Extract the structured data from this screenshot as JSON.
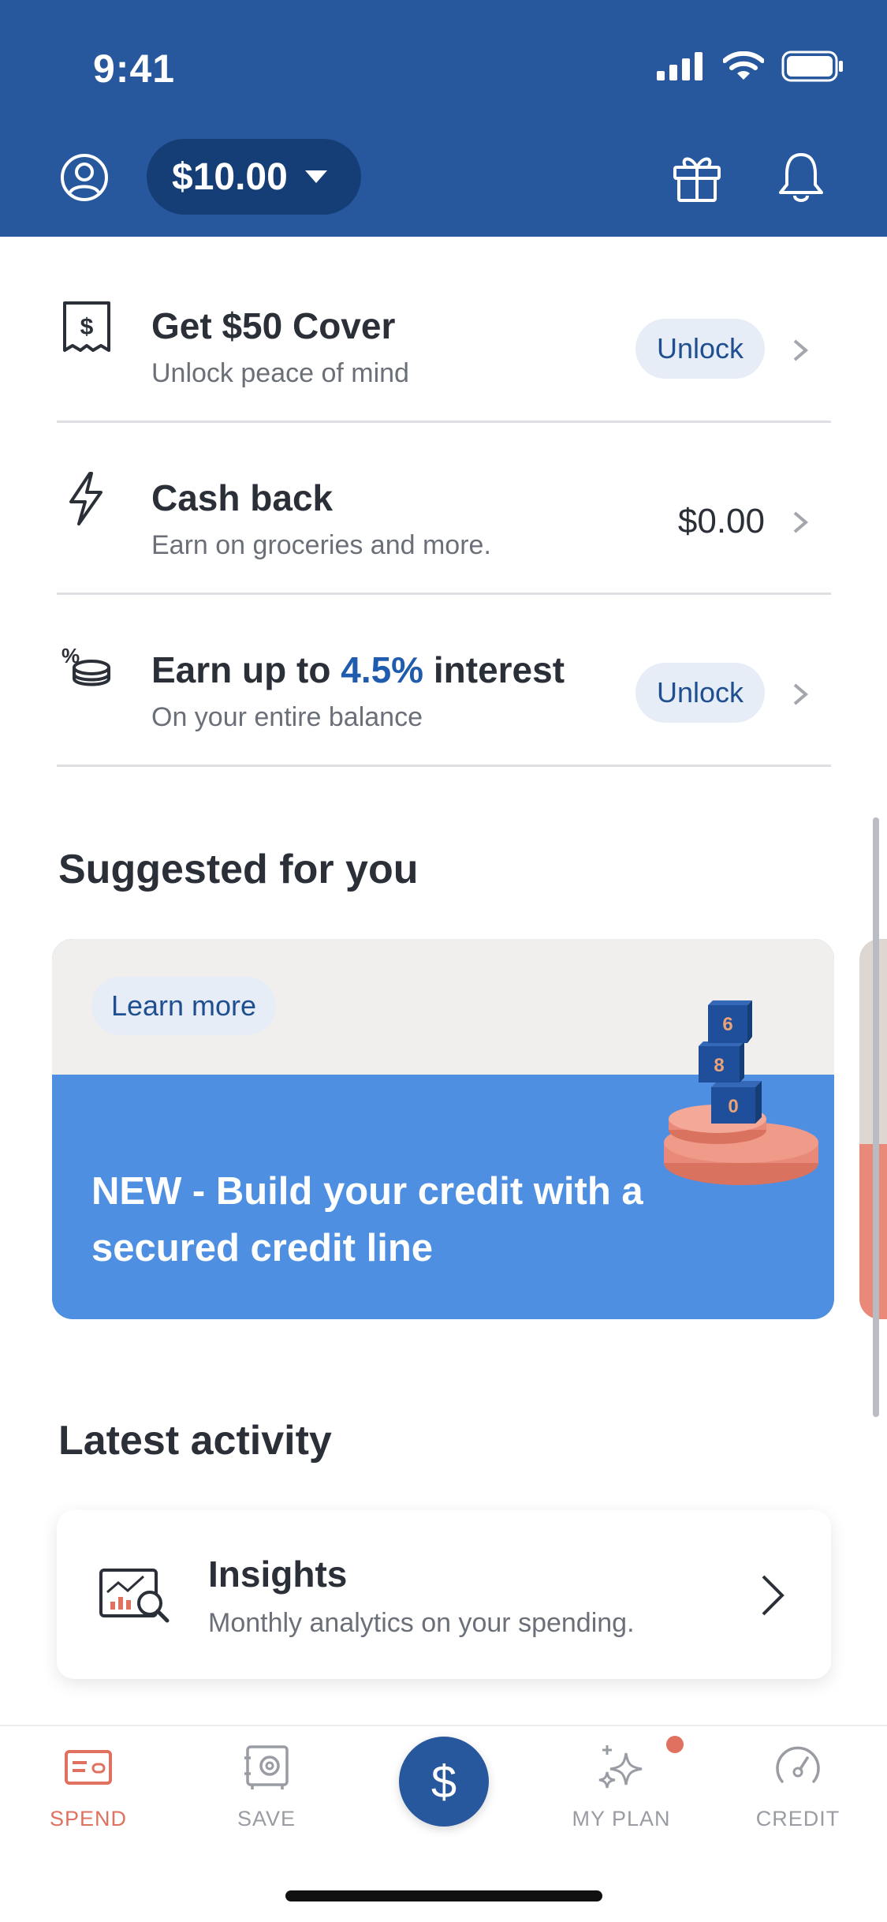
{
  "status_bar": {
    "time": "9:41"
  },
  "header": {
    "balance": "$10.00",
    "colors": {
      "header_bg": "#27579d",
      "pill_bg": "#163e76"
    }
  },
  "features": [
    {
      "title": "Get $50 Cover",
      "subtitle": "Unlock peace of mind",
      "action": "Unlock",
      "icon": "receipt-dollar-icon"
    },
    {
      "title": "Cash back",
      "subtitle": "Earn on groceries and more.",
      "value": "$0.00",
      "icon": "lightning-icon"
    },
    {
      "title_prefix": "Earn up to ",
      "title_accent": "4.5%",
      "title_suffix": " interest",
      "subtitle": "On your entire balance",
      "action": "Unlock",
      "icon": "percent-coins-icon"
    }
  ],
  "suggested": {
    "title": "Suggested for you",
    "card": {
      "learn_more": "Learn more",
      "text": "NEW - Build your credit with a secured credit line",
      "blocks": [
        "6",
        "8",
        "0"
      ]
    }
  },
  "latest": {
    "title": "Latest activity",
    "insights": {
      "title": "Insights",
      "subtitle": "Monthly analytics on your spending."
    }
  },
  "tabs": [
    {
      "label": "SPEND",
      "icon": "card-icon",
      "active": true
    },
    {
      "label": "SAVE",
      "icon": "safe-icon",
      "active": false
    },
    {
      "label": "$",
      "icon": "dollar-icon",
      "active": false
    },
    {
      "label": "MY PLAN",
      "icon": "sparkles-icon",
      "active": false
    },
    {
      "label": "CREDIT",
      "icon": "gauge-icon",
      "active": false
    }
  ],
  "colors": {
    "accent": "#1f5cae",
    "active_tab": "#e0705f",
    "promo_blue": "#4e8fe1"
  }
}
